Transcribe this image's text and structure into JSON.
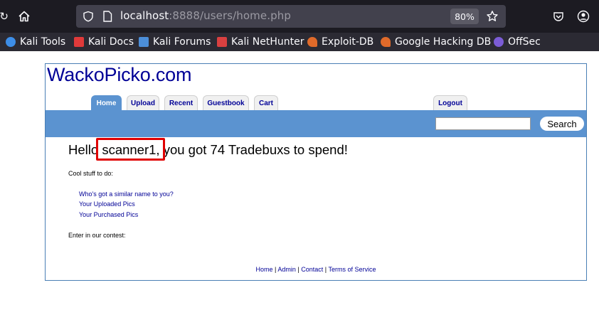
{
  "browser": {
    "url_host": "localhost",
    "url_path": ":8888/users/home.php",
    "zoom": "80%",
    "bookmarks": [
      {
        "label": "Kali Tools",
        "color": "#3d8ee8"
      },
      {
        "label": "Kali Docs",
        "color": "#e03a3a"
      },
      {
        "label": "Kali Forums",
        "color": "#4c8ed8"
      },
      {
        "label": "Kali NetHunter",
        "color": "#d94040"
      },
      {
        "label": "Exploit-DB",
        "color": "#e06a2a"
      },
      {
        "label": "Google Hacking DB",
        "color": "#e06a2a"
      },
      {
        "label": "OffSec",
        "color": "#7b5cd6"
      }
    ]
  },
  "site": {
    "logo": "WackoPicko.com",
    "tabs": [
      "Home",
      "Upload",
      "Recent",
      "Guestbook",
      "Cart"
    ],
    "logout": "Logout",
    "search_button": "Search",
    "greeting_pre": "Hello",
    "username": "scanner1",
    "greeting_post": ", you got 74 Tradebuxs to spend!",
    "cool_stuff": "Cool stuff to do:",
    "links": [
      "Who's got a similar name to you?",
      "Your Uploaded Pics",
      "Your Purchased Pics"
    ],
    "contest": "Enter in our contest:",
    "footer": [
      "Home",
      "Admin",
      "Contact",
      "Terms of Service"
    ],
    "accent": "#5b93d0",
    "link_color": "#000096",
    "highlight_color": "#e00000"
  }
}
